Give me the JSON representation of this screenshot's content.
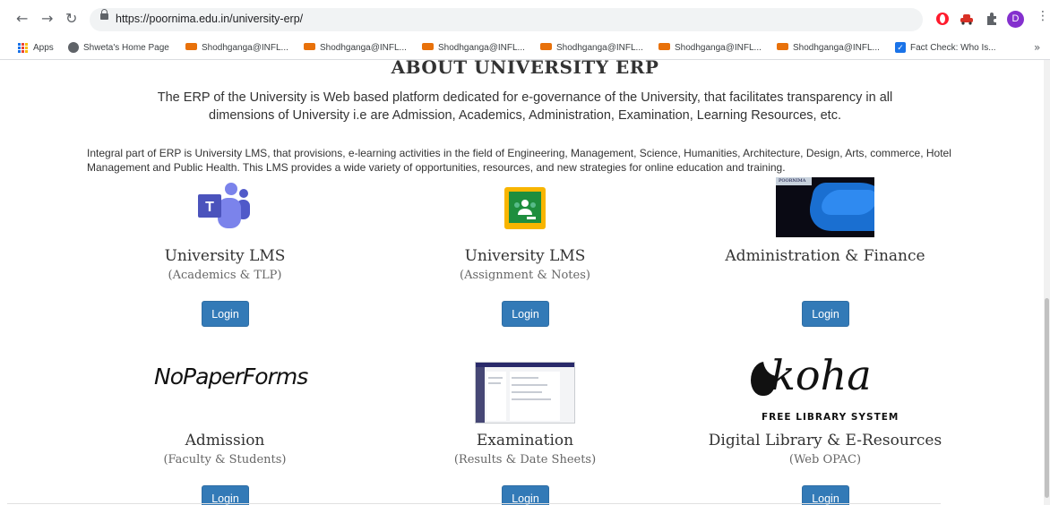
{
  "browser": {
    "url": "https://poornima.edu.in/university-erp/",
    "avatar_letter": "D",
    "bookmarks": [
      {
        "label": "Apps"
      },
      {
        "label": "Shweta's Home Page"
      },
      {
        "label": "Shodhganga@INFL..."
      },
      {
        "label": "Shodhganga@INFL..."
      },
      {
        "label": "Shodhganga@INFL..."
      },
      {
        "label": "Shodhganga@INFL..."
      },
      {
        "label": "Shodhganga@INFL..."
      },
      {
        "label": "Shodhganga@INFL..."
      },
      {
        "label": "Fact Check: Who Is..."
      }
    ],
    "more": "»"
  },
  "page": {
    "title": "ABOUT UNIVERSITY ERP",
    "intro": "The ERP of the University is Web based platform dedicated for e-governance of the University, that facilitates transparency in all dimensions of University i.e are Admission, Academics, Administration, Examination, Learning Resources, etc.",
    "integral": "Integral part of ERP is University LMS, that provisions, e-learning activities in the field of Engineering, Management, Science, Humanities, Architecture, Design, Arts, commerce, Hotel Management and Public Health. This LMS provides a wide variety of opportunities, resources, and new strategies for online education and training.",
    "cards": [
      {
        "title": "University LMS",
        "subtitle": "(Academics & TLP)",
        "button": "Login"
      },
      {
        "title": "University LMS",
        "subtitle": "(Assignment & Notes)",
        "button": "Login"
      },
      {
        "title": "Administration & Finance",
        "subtitle": "",
        "button": "Login"
      },
      {
        "title": "Admission",
        "subtitle": "(Faculty & Students)",
        "button": "Login"
      },
      {
        "title": "Examination",
        "subtitle": "(Results & Date Sheets)",
        "button": "Login"
      },
      {
        "title": "Digital Library & E-Resources",
        "subtitle": "(Web OPAC)",
        "button": "Login"
      }
    ],
    "logos": {
      "nopaperforms": "NoPaperForms",
      "koha_word": "koha",
      "koha_tag": "FREE LIBRARY SYSTEM",
      "admin_chip": "POORNIMA"
    }
  },
  "icons": {
    "back": "arrow-left-icon",
    "forward": "arrow-right-icon",
    "reload": "reload-icon"
  },
  "colors": {
    "button": "#337ab7",
    "teams": "#5059c9",
    "classroom_green": "#1e8e3e",
    "classroom_yellow": "#f8b500"
  }
}
